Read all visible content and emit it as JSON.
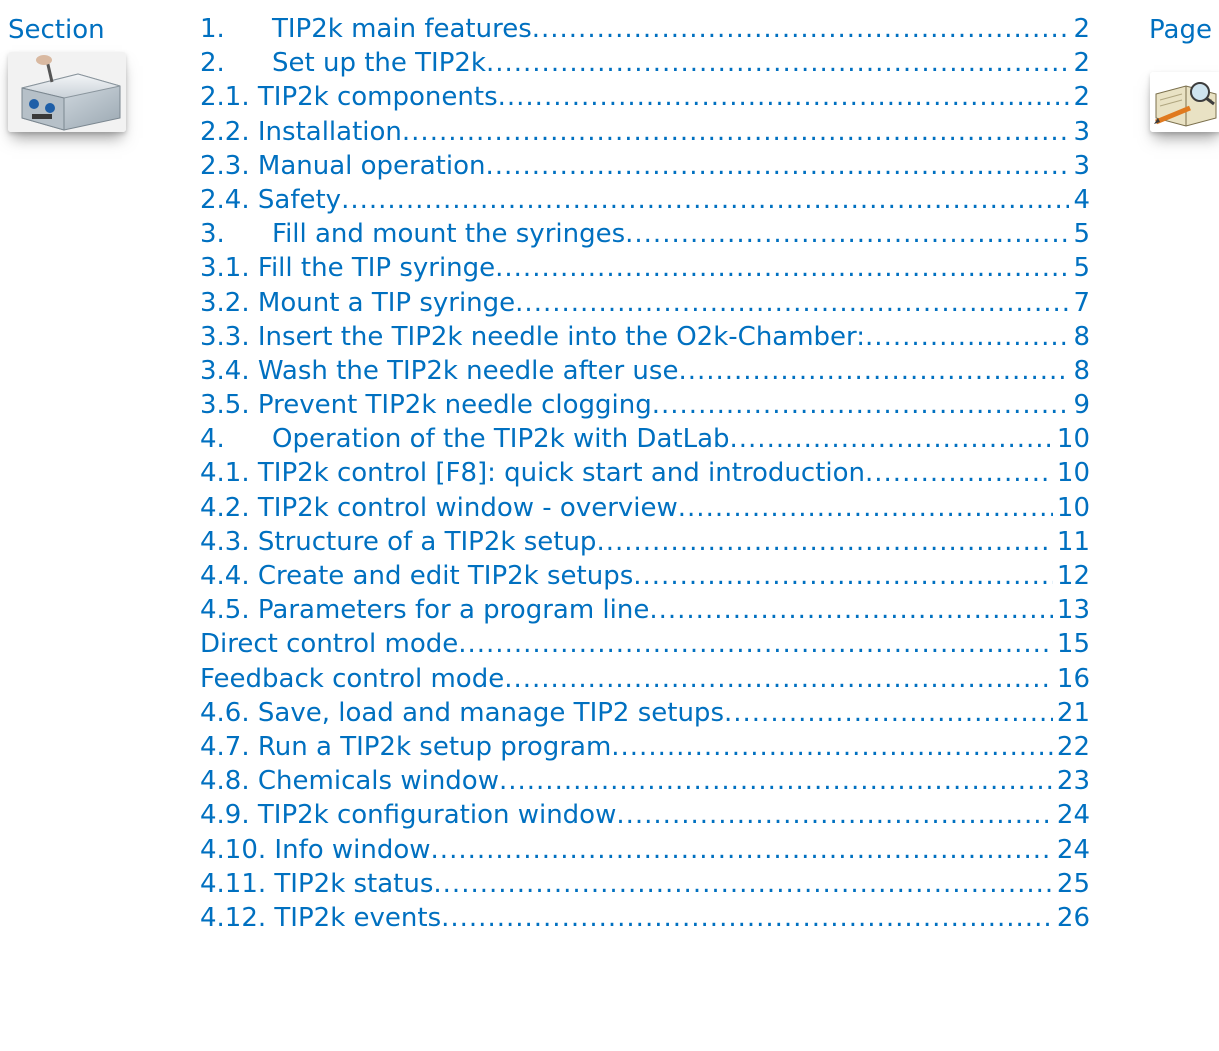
{
  "labels": {
    "section": "Section",
    "page": "Page"
  },
  "icons": {
    "section": "tip2k-device-icon",
    "page": "book-magnifier-pencil-icon"
  },
  "colors": {
    "text": "#0070c0"
  },
  "toc": [
    {
      "num": "1.",
      "title": "TIP2k main features",
      "page": "2"
    },
    {
      "num": "2.",
      "title": "Set up the TIP2k",
      "page": "2"
    },
    {
      "num": "2.1.",
      "title": "TIP2k components",
      "page": "2"
    },
    {
      "num": "2.2.",
      "title": "Installation",
      "page": "3"
    },
    {
      "num": "2.3.",
      "title": "Manual operation",
      "page": "3"
    },
    {
      "num": "2.4.",
      "title": "Safety",
      "page": "4"
    },
    {
      "num": "3.",
      "title": "Fill and mount the syringes",
      "page": "5"
    },
    {
      "num": "3.1.",
      "title": "Fill the TIP syringe",
      "page": "5"
    },
    {
      "num": "3.2.",
      "title": "Mount a TIP syringe",
      "page": "7"
    },
    {
      "num": "3.3.",
      "title": "Insert the TIP2k needle into the O2k-Chamber:",
      "page": "8"
    },
    {
      "num": "3.4.",
      "title": "Wash the TIP2k needle after use",
      "page": "8"
    },
    {
      "num": "3.5.",
      "title": "Prevent TIP2k needle clogging",
      "page": "9"
    },
    {
      "num": "4.",
      "title": "Operation of the TIP2k with DatLab",
      "page": "10"
    },
    {
      "num": "4.1.",
      "title": "TIP2k control [F8]: quick start and introduction",
      "page": "10"
    },
    {
      "num": "4.2.",
      "title": "TIP2k control window - overview",
      "page": "10"
    },
    {
      "num": "4.3.",
      "title": "Structure of a TIP2k setup",
      "page": "11"
    },
    {
      "num": "4.4.",
      "title": "Create and edit TIP2k setups",
      "page": "12"
    },
    {
      "num": "4.5.",
      "title": "Parameters for a program line",
      "page": "13"
    },
    {
      "num": "",
      "title": "Direct control mode",
      "page": "15"
    },
    {
      "num": "",
      "title": "Feedback control mode",
      "page": "16"
    },
    {
      "num": "4.6.",
      "title": "Save, load and manage TIP2 setups",
      "page": "21"
    },
    {
      "num": "4.7.",
      "title": "Run a TIP2k setup program",
      "page": "22"
    },
    {
      "num": "4.8.",
      "title": "Chemicals window",
      "page": "23"
    },
    {
      "num": "4.9.",
      "title": "TIP2k configuration window",
      "page": "24"
    },
    {
      "num": "4.10.",
      "title": "Info window",
      "page": "24"
    },
    {
      "num": "4.11.",
      "title": "TIP2k status",
      "page": "25"
    },
    {
      "num": "4.12.",
      "title": "TIP2k events",
      "page": "26"
    }
  ]
}
